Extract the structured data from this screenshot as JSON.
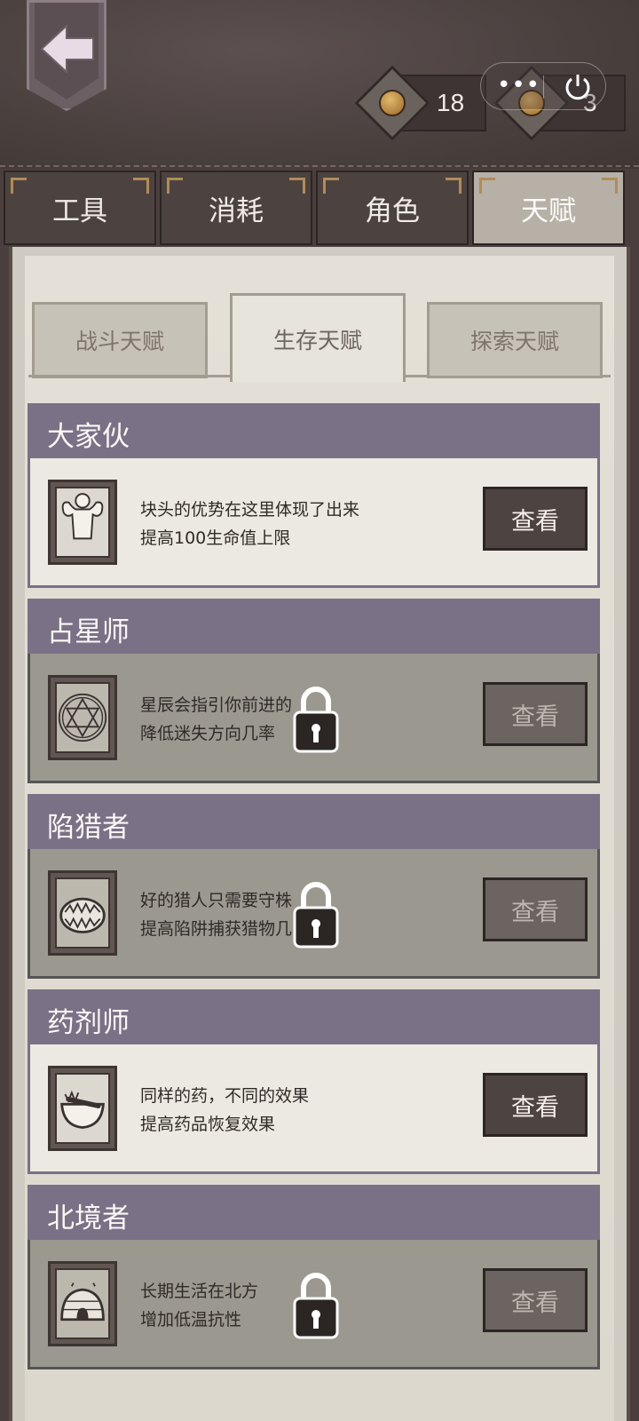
{
  "currencies": [
    {
      "icon": "coin-icon",
      "value": "18"
    },
    {
      "icon": "coin-icon",
      "value": "3"
    }
  ],
  "main_tabs": [
    {
      "label": "工具",
      "active": false
    },
    {
      "label": "消耗",
      "active": false
    },
    {
      "label": "角色",
      "active": false
    },
    {
      "label": "天赋",
      "active": true
    }
  ],
  "sub_tabs": [
    {
      "label": "战斗天赋",
      "active": false
    },
    {
      "label": "生存天赋",
      "active": true
    },
    {
      "label": "探索天赋",
      "active": false
    }
  ],
  "talents": [
    {
      "title": "大家伙",
      "line1": "块头的优势在这里体现了出来",
      "line2": "提高100生命值上限",
      "icon": "muscle-man-icon",
      "locked": false,
      "button": "查看"
    },
    {
      "title": "占星师",
      "line1": "星辰会指引你前进的",
      "line2": "降低迷失方向几率",
      "icon": "hexagram-icon",
      "locked": true,
      "button": "查看"
    },
    {
      "title": "陷猎者",
      "line1": "好的猎人只需要守株",
      "line2": "提高陷阱捕获猎物几",
      "icon": "bear-trap-icon",
      "locked": true,
      "button": "查看"
    },
    {
      "title": "药剂师",
      "line1": "同样的药，不同的效果",
      "line2": "提高药品恢复效果",
      "icon": "mortar-pestle-icon",
      "locked": false,
      "button": "查看"
    },
    {
      "title": "北境者",
      "line1": "长期生活在北方",
      "line2": "增加低温抗性",
      "icon": "igloo-icon",
      "locked": true,
      "button": "查看"
    }
  ],
  "colors": {
    "accent": "#7a7187",
    "dark": "#4d4441",
    "parchment": "#e4e0d7"
  }
}
